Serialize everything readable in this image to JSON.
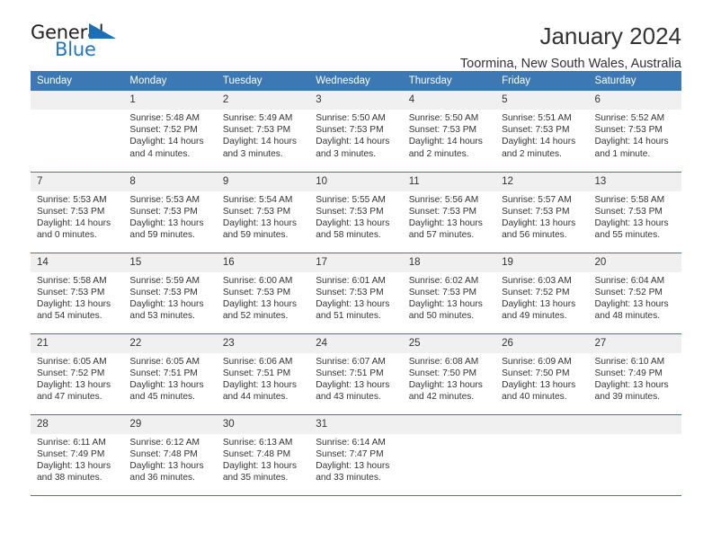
{
  "brand": {
    "name_part1": "General",
    "name_part2": "Blue"
  },
  "header": {
    "title": "January 2024",
    "subtitle": "Toormina, New South Wales, Australia"
  },
  "calendar": {
    "weekday_headers": [
      "Sunday",
      "Monday",
      "Tuesday",
      "Wednesday",
      "Thursday",
      "Friday",
      "Saturday"
    ],
    "accent_color": "#3c78b4",
    "daynum_band_color": "#f0f0f0",
    "weeks": [
      [
        {
          "day": "",
          "blank": true,
          "sunrise": "",
          "sunset": "",
          "daylight_line1": "",
          "daylight_line2": ""
        },
        {
          "day": "1",
          "blank": false,
          "sunrise": "Sunrise: 5:48 AM",
          "sunset": "Sunset: 7:52 PM",
          "daylight_line1": "Daylight: 14 hours",
          "daylight_line2": "and 4 minutes."
        },
        {
          "day": "2",
          "blank": false,
          "sunrise": "Sunrise: 5:49 AM",
          "sunset": "Sunset: 7:53 PM",
          "daylight_line1": "Daylight: 14 hours",
          "daylight_line2": "and 3 minutes."
        },
        {
          "day": "3",
          "blank": false,
          "sunrise": "Sunrise: 5:50 AM",
          "sunset": "Sunset: 7:53 PM",
          "daylight_line1": "Daylight: 14 hours",
          "daylight_line2": "and 3 minutes."
        },
        {
          "day": "4",
          "blank": false,
          "sunrise": "Sunrise: 5:50 AM",
          "sunset": "Sunset: 7:53 PM",
          "daylight_line1": "Daylight: 14 hours",
          "daylight_line2": "and 2 minutes."
        },
        {
          "day": "5",
          "blank": false,
          "sunrise": "Sunrise: 5:51 AM",
          "sunset": "Sunset: 7:53 PM",
          "daylight_line1": "Daylight: 14 hours",
          "daylight_line2": "and 2 minutes."
        },
        {
          "day": "6",
          "blank": false,
          "sunrise": "Sunrise: 5:52 AM",
          "sunset": "Sunset: 7:53 PM",
          "daylight_line1": "Daylight: 14 hours",
          "daylight_line2": "and 1 minute."
        }
      ],
      [
        {
          "day": "7",
          "blank": false,
          "sunrise": "Sunrise: 5:53 AM",
          "sunset": "Sunset: 7:53 PM",
          "daylight_line1": "Daylight: 14 hours",
          "daylight_line2": "and 0 minutes."
        },
        {
          "day": "8",
          "blank": false,
          "sunrise": "Sunrise: 5:53 AM",
          "sunset": "Sunset: 7:53 PM",
          "daylight_line1": "Daylight: 13 hours",
          "daylight_line2": "and 59 minutes."
        },
        {
          "day": "9",
          "blank": false,
          "sunrise": "Sunrise: 5:54 AM",
          "sunset": "Sunset: 7:53 PM",
          "daylight_line1": "Daylight: 13 hours",
          "daylight_line2": "and 59 minutes."
        },
        {
          "day": "10",
          "blank": false,
          "sunrise": "Sunrise: 5:55 AM",
          "sunset": "Sunset: 7:53 PM",
          "daylight_line1": "Daylight: 13 hours",
          "daylight_line2": "and 58 minutes."
        },
        {
          "day": "11",
          "blank": false,
          "sunrise": "Sunrise: 5:56 AM",
          "sunset": "Sunset: 7:53 PM",
          "daylight_line1": "Daylight: 13 hours",
          "daylight_line2": "and 57 minutes."
        },
        {
          "day": "12",
          "blank": false,
          "sunrise": "Sunrise: 5:57 AM",
          "sunset": "Sunset: 7:53 PM",
          "daylight_line1": "Daylight: 13 hours",
          "daylight_line2": "and 56 minutes."
        },
        {
          "day": "13",
          "blank": false,
          "sunrise": "Sunrise: 5:58 AM",
          "sunset": "Sunset: 7:53 PM",
          "daylight_line1": "Daylight: 13 hours",
          "daylight_line2": "and 55 minutes."
        }
      ],
      [
        {
          "day": "14",
          "blank": false,
          "sunrise": "Sunrise: 5:58 AM",
          "sunset": "Sunset: 7:53 PM",
          "daylight_line1": "Daylight: 13 hours",
          "daylight_line2": "and 54 minutes."
        },
        {
          "day": "15",
          "blank": false,
          "sunrise": "Sunrise: 5:59 AM",
          "sunset": "Sunset: 7:53 PM",
          "daylight_line1": "Daylight: 13 hours",
          "daylight_line2": "and 53 minutes."
        },
        {
          "day": "16",
          "blank": false,
          "sunrise": "Sunrise: 6:00 AM",
          "sunset": "Sunset: 7:53 PM",
          "daylight_line1": "Daylight: 13 hours",
          "daylight_line2": "and 52 minutes."
        },
        {
          "day": "17",
          "blank": false,
          "sunrise": "Sunrise: 6:01 AM",
          "sunset": "Sunset: 7:53 PM",
          "daylight_line1": "Daylight: 13 hours",
          "daylight_line2": "and 51 minutes."
        },
        {
          "day": "18",
          "blank": false,
          "sunrise": "Sunrise: 6:02 AM",
          "sunset": "Sunset: 7:53 PM",
          "daylight_line1": "Daylight: 13 hours",
          "daylight_line2": "and 50 minutes."
        },
        {
          "day": "19",
          "blank": false,
          "sunrise": "Sunrise: 6:03 AM",
          "sunset": "Sunset: 7:52 PM",
          "daylight_line1": "Daylight: 13 hours",
          "daylight_line2": "and 49 minutes."
        },
        {
          "day": "20",
          "blank": false,
          "sunrise": "Sunrise: 6:04 AM",
          "sunset": "Sunset: 7:52 PM",
          "daylight_line1": "Daylight: 13 hours",
          "daylight_line2": "and 48 minutes."
        }
      ],
      [
        {
          "day": "21",
          "blank": false,
          "sunrise": "Sunrise: 6:05 AM",
          "sunset": "Sunset: 7:52 PM",
          "daylight_line1": "Daylight: 13 hours",
          "daylight_line2": "and 47 minutes."
        },
        {
          "day": "22",
          "blank": false,
          "sunrise": "Sunrise: 6:05 AM",
          "sunset": "Sunset: 7:51 PM",
          "daylight_line1": "Daylight: 13 hours",
          "daylight_line2": "and 45 minutes."
        },
        {
          "day": "23",
          "blank": false,
          "sunrise": "Sunrise: 6:06 AM",
          "sunset": "Sunset: 7:51 PM",
          "daylight_line1": "Daylight: 13 hours",
          "daylight_line2": "and 44 minutes."
        },
        {
          "day": "24",
          "blank": false,
          "sunrise": "Sunrise: 6:07 AM",
          "sunset": "Sunset: 7:51 PM",
          "daylight_line1": "Daylight: 13 hours",
          "daylight_line2": "and 43 minutes."
        },
        {
          "day": "25",
          "blank": false,
          "sunrise": "Sunrise: 6:08 AM",
          "sunset": "Sunset: 7:50 PM",
          "daylight_line1": "Daylight: 13 hours",
          "daylight_line2": "and 42 minutes."
        },
        {
          "day": "26",
          "blank": false,
          "sunrise": "Sunrise: 6:09 AM",
          "sunset": "Sunset: 7:50 PM",
          "daylight_line1": "Daylight: 13 hours",
          "daylight_line2": "and 40 minutes."
        },
        {
          "day": "27",
          "blank": false,
          "sunrise": "Sunrise: 6:10 AM",
          "sunset": "Sunset: 7:49 PM",
          "daylight_line1": "Daylight: 13 hours",
          "daylight_line2": "and 39 minutes."
        }
      ],
      [
        {
          "day": "28",
          "blank": false,
          "sunrise": "Sunrise: 6:11 AM",
          "sunset": "Sunset: 7:49 PM",
          "daylight_line1": "Daylight: 13 hours",
          "daylight_line2": "and 38 minutes."
        },
        {
          "day": "29",
          "blank": false,
          "sunrise": "Sunrise: 6:12 AM",
          "sunset": "Sunset: 7:48 PM",
          "daylight_line1": "Daylight: 13 hours",
          "daylight_line2": "and 36 minutes."
        },
        {
          "day": "30",
          "blank": false,
          "sunrise": "Sunrise: 6:13 AM",
          "sunset": "Sunset: 7:48 PM",
          "daylight_line1": "Daylight: 13 hours",
          "daylight_line2": "and 35 minutes."
        },
        {
          "day": "31",
          "blank": false,
          "sunrise": "Sunrise: 6:14 AM",
          "sunset": "Sunset: 7:47 PM",
          "daylight_line1": "Daylight: 13 hours",
          "daylight_line2": "and 33 minutes."
        },
        {
          "day": "",
          "blank": true,
          "sunrise": "",
          "sunset": "",
          "daylight_line1": "",
          "daylight_line2": ""
        },
        {
          "day": "",
          "blank": true,
          "sunrise": "",
          "sunset": "",
          "daylight_line1": "",
          "daylight_line2": ""
        },
        {
          "day": "",
          "blank": true,
          "sunrise": "",
          "sunset": "",
          "daylight_line1": "",
          "daylight_line2": ""
        }
      ]
    ]
  }
}
